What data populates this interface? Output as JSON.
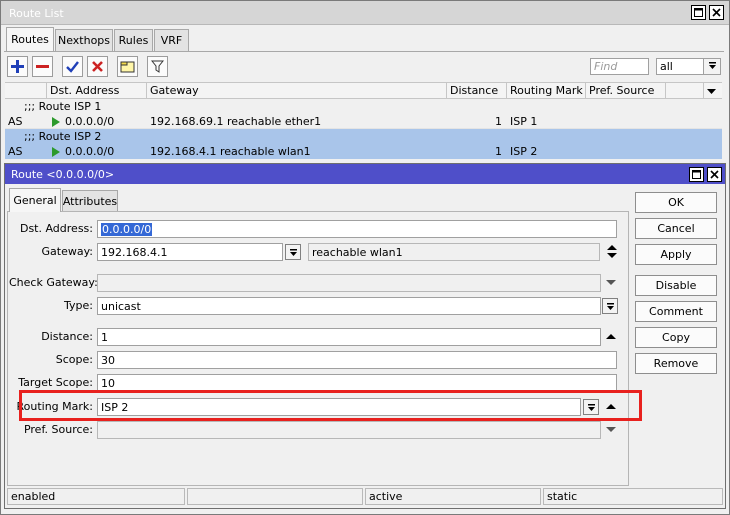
{
  "route_list": {
    "title": "Route List",
    "tabs": [
      {
        "label": "Routes"
      },
      {
        "label": "Nexthops"
      },
      {
        "label": "Rules"
      },
      {
        "label": "VRF"
      }
    ],
    "find_placeholder": "Find",
    "filter_value": "all",
    "columns": [
      "",
      "Dst. Address",
      "Gateway",
      "Distance",
      "Routing Mark",
      "Pref. Source"
    ],
    "rows": [
      {
        "kind": "comment",
        "text": ";;; Route ISP 1"
      },
      {
        "kind": "route",
        "flags": "AS",
        "dst": "0.0.0.0/0",
        "gateway": "192.168.69.1 reachable ether1",
        "distance": "1",
        "mark": "ISP 1",
        "pref": ""
      },
      {
        "kind": "comment",
        "text": ";;; Route ISP 2"
      },
      {
        "kind": "route",
        "flags": "AS",
        "dst": "0.0.0.0/0",
        "gateway": "192.168.4.1 reachable wlan1",
        "distance": "1",
        "mark": "ISP 2",
        "pref": ""
      }
    ]
  },
  "route_dialog": {
    "title": "Route <0.0.0.0/0>",
    "tabs": [
      {
        "label": "General"
      },
      {
        "label": "Attributes"
      }
    ],
    "fields": {
      "dst_label": "Dst. Address:",
      "dst_value": "0.0.0.0/0",
      "gateway_label": "Gateway:",
      "gateway_value": "192.168.4.1",
      "gateway_status": "reachable wlan1",
      "check_gateway_label": "Check Gateway:",
      "check_gateway_value": "",
      "type_label": "Type:",
      "type_value": "unicast",
      "distance_label": "Distance:",
      "distance_value": "1",
      "scope_label": "Scope:",
      "scope_value": "30",
      "target_scope_label": "Target Scope:",
      "target_scope_value": "10",
      "routing_mark_label": "Routing Mark:",
      "routing_mark_value": "ISP 2",
      "pref_source_label": "Pref. Source:",
      "pref_source_value": ""
    },
    "buttons": {
      "ok": "OK",
      "cancel": "Cancel",
      "apply": "Apply",
      "disable": "Disable",
      "comment": "Comment",
      "copy": "Copy",
      "remove": "Remove"
    },
    "status": [
      "enabled",
      "",
      "active",
      "static"
    ]
  },
  "colors": {
    "highlight": "#e8211e",
    "selected_row": "#a9c5ea",
    "dialog_title": "#4f4fc9",
    "add": "#1f3fb8",
    "remove": "#cc2222"
  },
  "icons": {
    "add": "plus-icon",
    "remove": "minus-icon",
    "enable": "check-icon",
    "disable": "x-icon",
    "comment": "note-icon",
    "filter": "funnel-icon"
  }
}
